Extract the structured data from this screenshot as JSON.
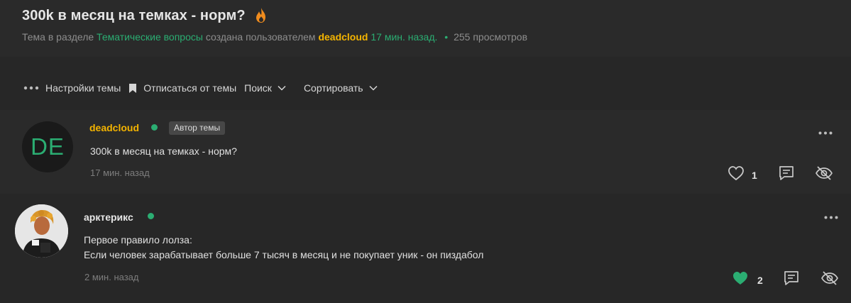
{
  "thread": {
    "title": "300k в месяц на темках - норм?",
    "meta": {
      "prefix": "Тема в разделе",
      "section": "Тематические вопросы",
      "created_by": "создана пользователем",
      "author": "deadcloud",
      "time": "17 мин. назад.",
      "separator": "•",
      "views": "255 просмотров"
    }
  },
  "toolbar": {
    "settings_label": "Настройки темы",
    "unsubscribe_label": "Отписаться от темы",
    "search_label": "Поиск",
    "sort_label": "Сортировать"
  },
  "posts": [
    {
      "avatar_initials": "DE",
      "username": "deadcloud",
      "badge": "Автор темы",
      "text": "300k в месяц на темках - норм?",
      "time": "17 мин. назад",
      "likes": "1"
    },
    {
      "username": "арктерикс",
      "text_line1": "Первое правило лолза:",
      "text_line2": "Если человек зарабатывает больше 7 тысяч в месяц и не покупает уник - он пиздабол",
      "time": "2 мин. назад",
      "likes": "2"
    }
  ],
  "colors": {
    "accent_green": "#2bad72",
    "author_gold": "#f4b400",
    "fire_orange": "#f08c1e"
  },
  "icons": {
    "fire": "fire-icon",
    "dots": "more-dots-icon",
    "bookmark": "bookmark-icon",
    "chevron": "chevron-down-icon",
    "heart": "heart-icon",
    "reply": "reply-icon",
    "hide": "hide-eye-icon"
  }
}
